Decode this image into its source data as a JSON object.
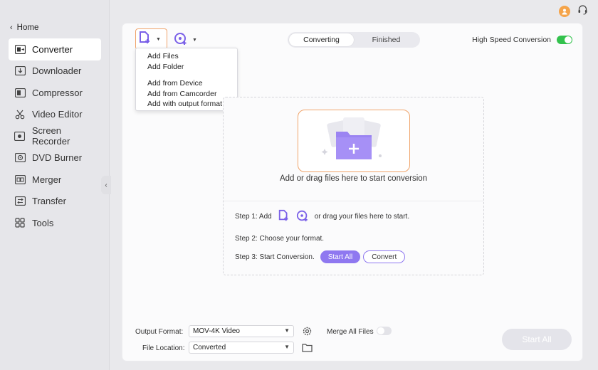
{
  "sidebar": {
    "home_label": "Home",
    "items": [
      {
        "label": "Converter",
        "icon": "converter-icon"
      },
      {
        "label": "Downloader",
        "icon": "downloader-icon"
      },
      {
        "label": "Compressor",
        "icon": "compressor-icon"
      },
      {
        "label": "Video Editor",
        "icon": "scissors-icon"
      },
      {
        "label": "Screen Recorder",
        "icon": "screen-recorder-icon"
      },
      {
        "label": "DVD Burner",
        "icon": "dvd-burner-icon"
      },
      {
        "label": "Merger",
        "icon": "merger-icon"
      },
      {
        "label": "Transfer",
        "icon": "transfer-icon"
      },
      {
        "label": "Tools",
        "icon": "grid-icon"
      }
    ],
    "active_item": "Converter"
  },
  "tabs": [
    {
      "label": "Converting",
      "active": true
    },
    {
      "label": "Finished",
      "active": false
    }
  ],
  "high_speed": {
    "label": "High Speed Conversion",
    "enabled": true
  },
  "add_menu": {
    "group1": [
      "Add Files",
      "Add Folder"
    ],
    "group2": [
      "Add from Device",
      "Add from Camcorder",
      "Add with output format"
    ]
  },
  "drop_area": {
    "message": "Add or drag files here to start conversion",
    "step1_prefix": "Step 1: Add",
    "step1_suffix": "or drag your files here to start.",
    "step2": "Step 2: Choose your format.",
    "step3": "Step 3: Start Conversion.",
    "start_all_label": "Start  All",
    "convert_label": "Convert"
  },
  "bottom": {
    "output_format_label": "Output Format:",
    "output_format_value": "MOV-4K Video",
    "merge_label": "Merge All Files",
    "merge_enabled": false,
    "file_location_label": "File Location:",
    "file_location_value": "Converted",
    "start_all_label": "Start All"
  },
  "colors": {
    "accent": "#8f78f0",
    "highlight": "#f0a46b",
    "toggle_on": "#33c24d"
  }
}
